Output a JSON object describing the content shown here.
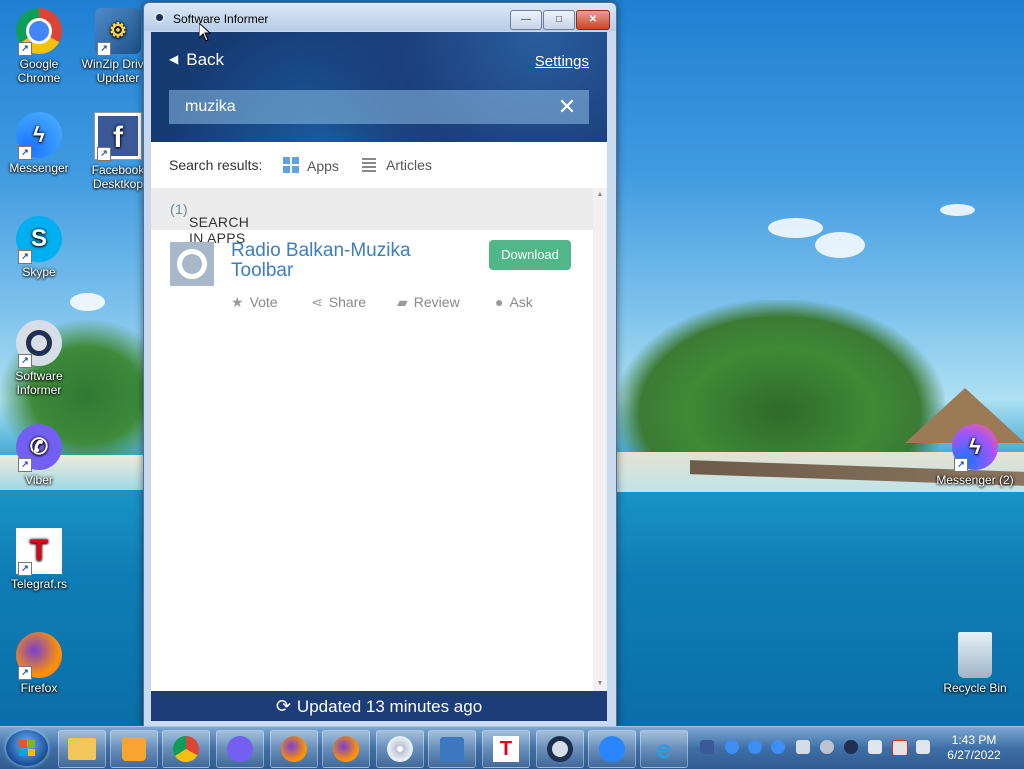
{
  "window": {
    "title": "Software Informer",
    "minimize_label": "—",
    "maximize_label": "□",
    "close_label": "✕",
    "back_label": "Back",
    "settings_label": "Settings",
    "search": {
      "value": "muzika",
      "placeholder": ""
    },
    "search_results_label": "Search results:",
    "tabs": [
      {
        "label": "Apps"
      },
      {
        "label": "Articles"
      }
    ],
    "section_heading": "SEARCH IN APPS",
    "section_count": "(1)",
    "results": [
      {
        "title": "Radio Balkan-Muzika Toolbar",
        "download_label": "Download",
        "actions": {
          "vote": "Vote",
          "share": "Share",
          "review": "Review",
          "ask": "Ask"
        }
      }
    ],
    "footer_status": "Updated 13 minutes ago"
  },
  "desktop_icons": [
    {
      "label": "Google Chrome",
      "icon": "chrome-icon"
    },
    {
      "label": "WinZip Driver Updater",
      "icon": "winzip-driver-updater-icon"
    },
    {
      "label": "Messenger",
      "icon": "messenger-icon"
    },
    {
      "label": "Facebook Desktkop",
      "icon": "facebook-icon"
    },
    {
      "label": "Skype",
      "icon": "skype-icon"
    },
    {
      "label": "Software Informer",
      "icon": "software-informer-icon"
    },
    {
      "label": "Viber",
      "icon": "viber-icon"
    },
    {
      "label": "Telegraf.rs",
      "icon": "telegraf-icon"
    },
    {
      "label": "Firefox",
      "icon": "firefox-icon"
    },
    {
      "label": "Messenger (2)",
      "icon": "messenger-icon"
    },
    {
      "label": "Recycle Bin",
      "icon": "recycle-bin-icon"
    }
  ],
  "taskbar": {
    "clock_time": "1:43 PM",
    "clock_date": "6/27/2022"
  },
  "colors": {
    "header_bg": "#163a72",
    "accent_link": "#3a7fc1",
    "download_green": "#52b788",
    "footer_bg": "#1d3d79"
  }
}
